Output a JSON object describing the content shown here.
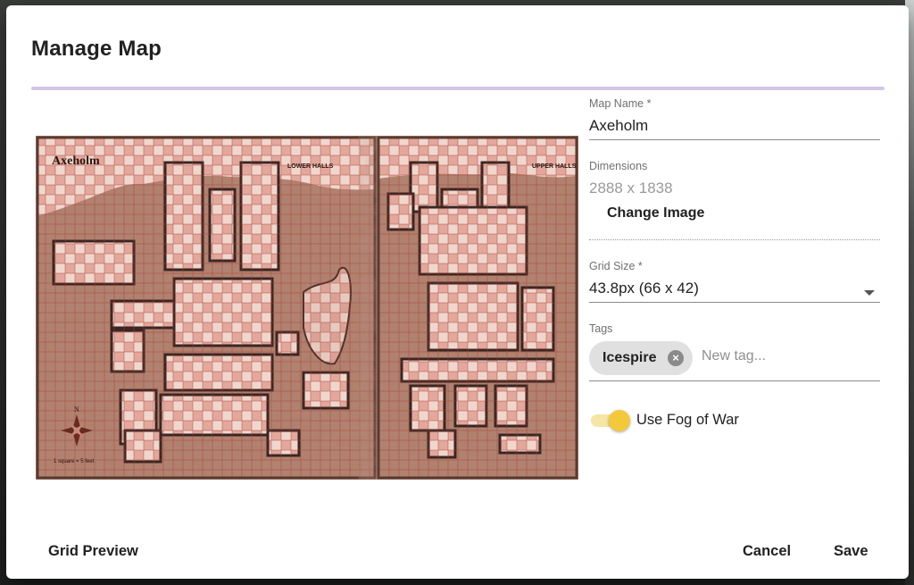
{
  "dialog": {
    "title": "Manage Map"
  },
  "map": {
    "name": "Axeholm",
    "left_page_label": "LOWER HALLS",
    "right_page_label": "UPPER HALLS",
    "scale_note": "1 square = 5 feet",
    "compass_letter": "N"
  },
  "form": {
    "map_name_label": "Map Name *",
    "map_name_value": "Axeholm",
    "dimensions_label": "Dimensions",
    "dimensions_value": "2888 x 1838",
    "change_image_label": "Change Image",
    "grid_size_label": "Grid Size *",
    "grid_size_value": "43.8px (66 x 42)",
    "tags_label": "Tags",
    "tags": [
      "Icespire"
    ],
    "tag_remove_icon": "close-circle-icon",
    "new_tag_placeholder": "New tag...",
    "fog_of_war_label": "Use Fog of War",
    "fog_of_war_enabled": true
  },
  "footer": {
    "grid_preview_label": "Grid Preview",
    "cancel_label": "Cancel",
    "save_label": "Save"
  },
  "colors": {
    "accent": "#d3c4e6",
    "toggle_thumb": "#f3c93b",
    "toggle_track": "#f5e6a6",
    "map_red": "#a94a3e"
  }
}
